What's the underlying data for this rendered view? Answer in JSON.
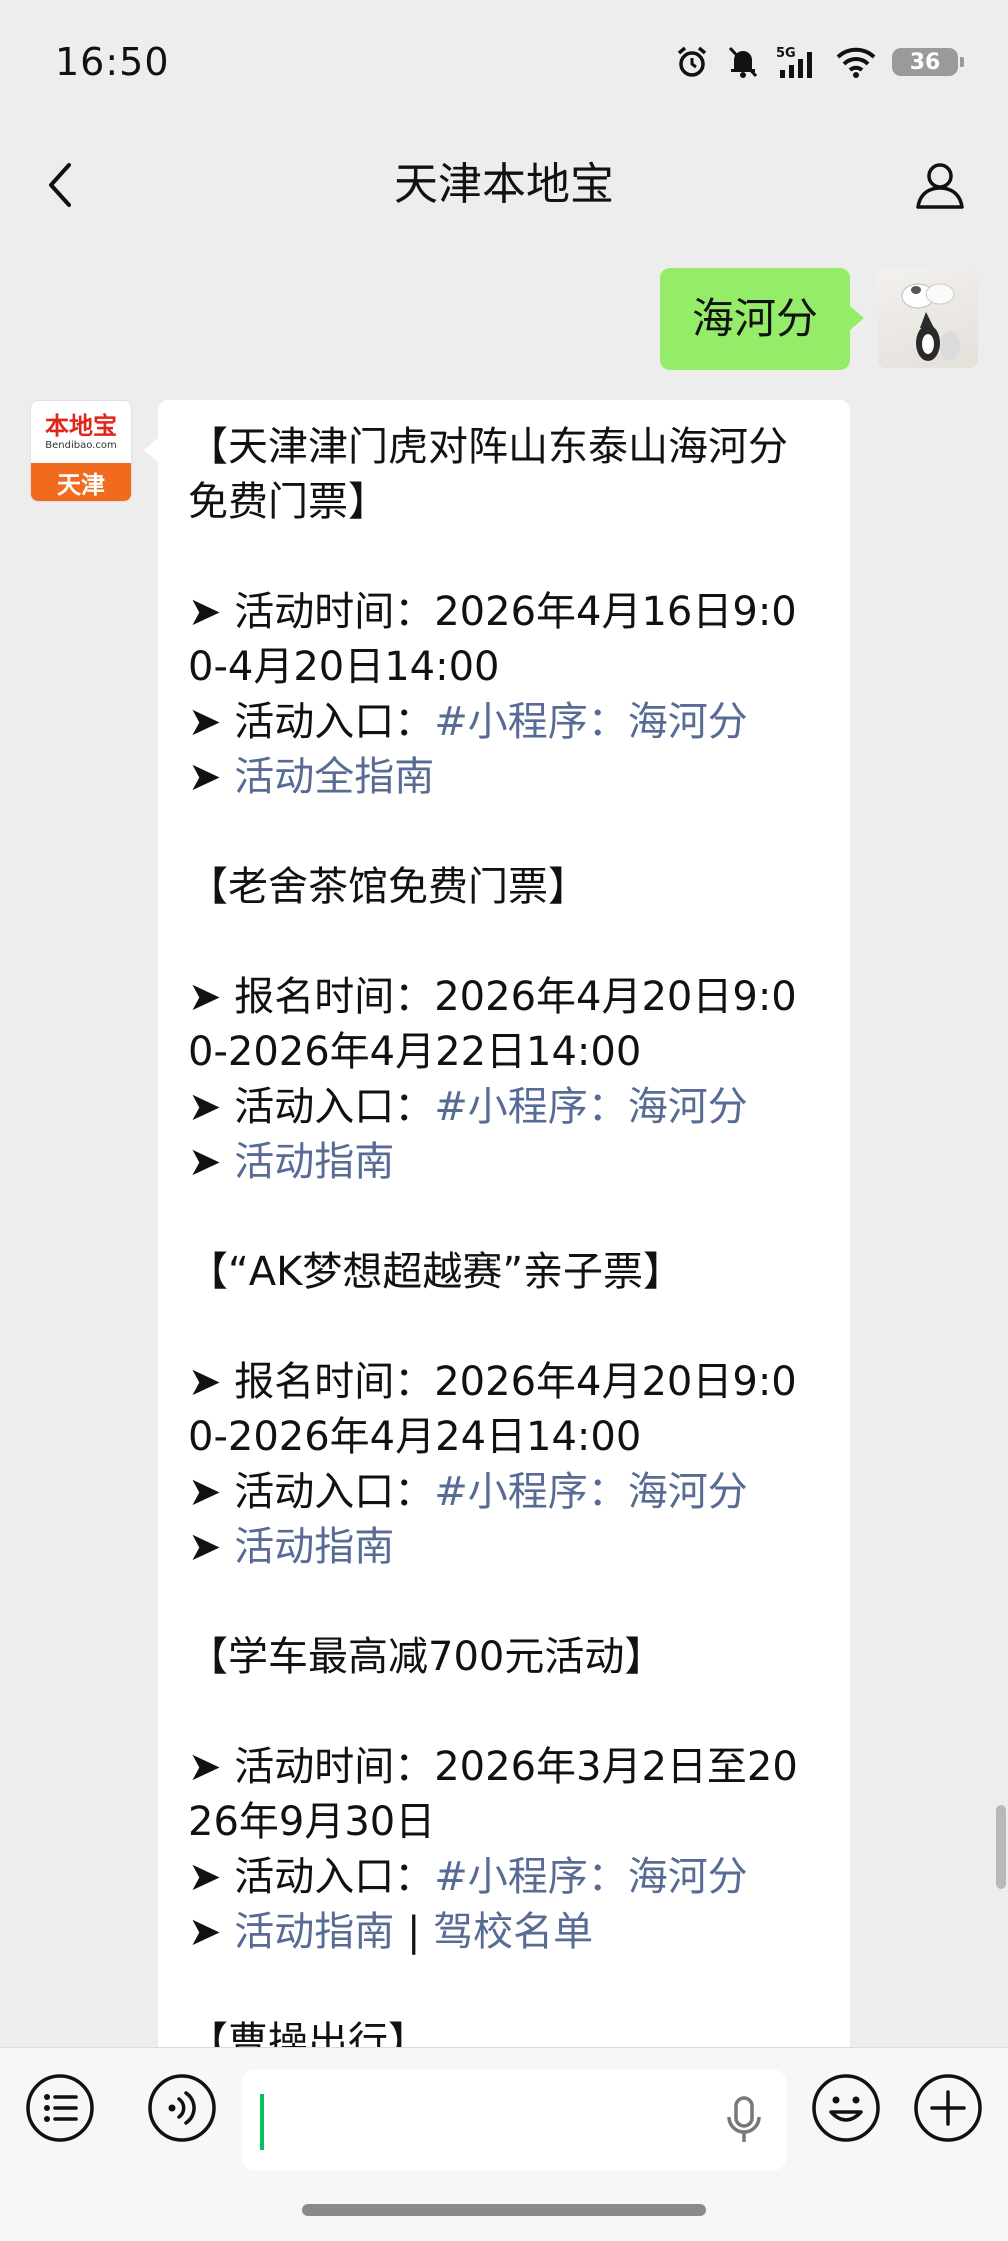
{
  "status_bar": {
    "time": "16:50",
    "network": "5G",
    "battery": "36"
  },
  "nav": {
    "title": "天津本地宝"
  },
  "chat": {
    "sent": {
      "text": "海河分"
    },
    "bot": {
      "logo_text": "本地宝",
      "logo_domain": "Bendibao.com",
      "logo_city": "天津"
    },
    "message": {
      "l1": "【天津津门虎对阵山东泰山海河分免费门票】",
      "l2_prefix": "➤ 活动时间：",
      "l2": "2026年4月16日9:00-4月20日14:00",
      "l3_prefix": "➤ 活动入口：",
      "l3_link": "#小程序：海河分",
      "l4_prefix": "➤ ",
      "l4_link": "活动全指南",
      "l5": "【老舍茶馆免费门票】",
      "l6_prefix": "➤ 报名时间：",
      "l6": "2026年4月20日9:00-2026年4月22日14:00",
      "l7_prefix": "➤ 活动入口：",
      "l7_link": "#小程序：海河分",
      "l8_prefix": "➤ ",
      "l8_link": "活动指南",
      "l9": "【“AK梦想超越赛”亲子票】",
      "l10_prefix": "➤ 报名时间：",
      "l10": "2026年4月20日9:00-2026年4月24日14:00",
      "l11_prefix": "➤ 活动入口：",
      "l11_link": "#小程序：海河分",
      "l12_prefix": "➤ ",
      "l12_link": "活动指南",
      "l13": "【学车最高减700元活动】",
      "l14_prefix": "➤ 活动时间：",
      "l14": "2026年3月2日至2026年9月30日",
      "l15_prefix": "➤ 活动入口：",
      "l15_link": "#小程序：海河分",
      "l16_prefix": "➤ ",
      "l16_link_a": "活动指南",
      "l16_sep": " | ",
      "l16_link_b": "驾校名单",
      "l17": "【曹操出行】"
    }
  },
  "colors": {
    "link": "#576b95",
    "sent_bubble": "#95ec69",
    "background": "#ededed"
  }
}
